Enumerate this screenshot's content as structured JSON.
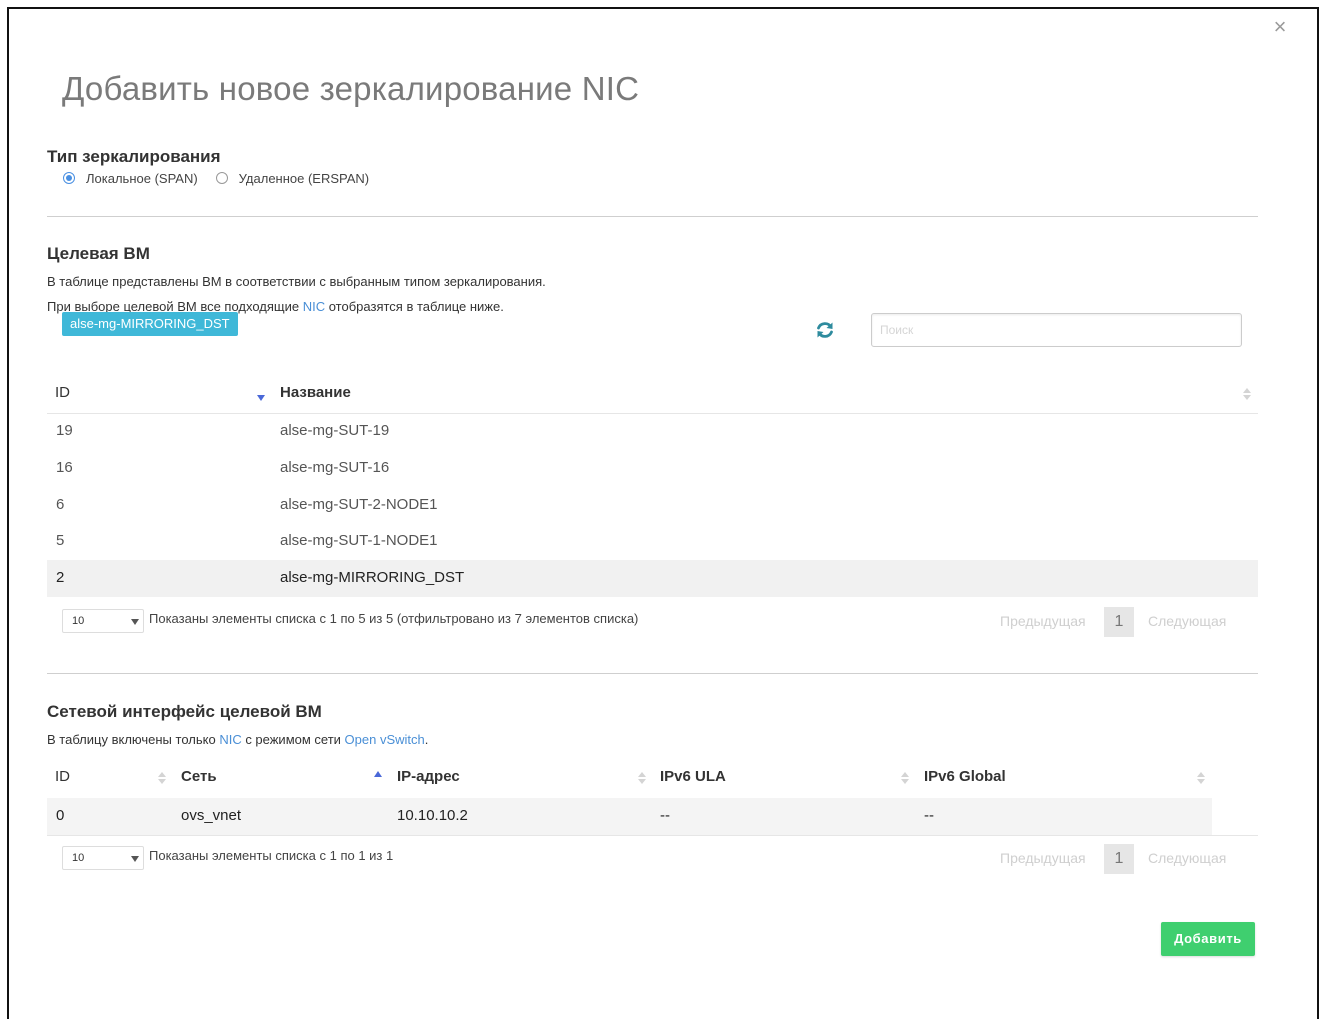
{
  "dialog": {
    "title": "Добавить новое зеркалирование NIC",
    "close_symbol": "×",
    "add_button": "Добавить"
  },
  "mirroring_type": {
    "heading": "Тип зеркалирования",
    "options": [
      {
        "label": "Локальное (SPAN)",
        "selected": true
      },
      {
        "label": "Удаленное (ERSPAN)",
        "selected": false
      }
    ]
  },
  "target_vm": {
    "heading": "Целевая ВМ",
    "desc1": "В таблице представлены ВМ в соответствии с выбранным типом зеркалирования.",
    "desc2_part1": "При выборе целевой ВМ все подходящие ",
    "desc2_link": "NIC",
    "desc2_part2": " отобразятся в таблице ниже.",
    "selected_tag": "alse-mg-MIRRORING_DST",
    "search_placeholder": "Поиск",
    "columns": [
      "ID",
      "Название"
    ],
    "rows": [
      {
        "id": "19",
        "name": "alse-mg-SUT-19",
        "selected": false
      },
      {
        "id": "16",
        "name": "alse-mg-SUT-16",
        "selected": false
      },
      {
        "id": "6",
        "name": "alse-mg-SUT-2-NODE1",
        "selected": false
      },
      {
        "id": "5",
        "name": "alse-mg-SUT-1-NODE1",
        "selected": false
      },
      {
        "id": "2",
        "name": "alse-mg-MIRRORING_DST",
        "selected": true
      }
    ],
    "page_size": "10",
    "info": "Показаны элементы списка с 1 по 5 из 5 (отфильтровано из 7 элементов списка)",
    "prev": "Предыдущая",
    "page": "1",
    "next": "Следующая"
  },
  "nic_table": {
    "heading": "Сетевой интерфейс целевой ВМ",
    "desc_part1": "В таблицу включены только ",
    "desc_link1": "NIC",
    "desc_part2": " с режимом сети ",
    "desc_link2": "Open vSwitch",
    "desc_part3": ".",
    "columns": [
      "ID",
      "Сеть",
      "IP-адрес",
      "IPv6 ULA",
      "IPv6 Global"
    ],
    "rows": [
      {
        "id": "0",
        "network": "ovs_vnet",
        "ip": "10.10.10.2",
        "ipv6_ula": "--",
        "ipv6_global": "--"
      }
    ],
    "page_size": "10",
    "info": "Показаны элементы списка с 1 по 1 из 1",
    "prev": "Предыдущая",
    "page": "1",
    "next": "Следующая"
  },
  "colors": {
    "accent_tag": "#3fb8d8",
    "add_button": "#3fcf6f",
    "sort_active": "#4a68d8",
    "link": "#4a8fd6"
  },
  "icons": [
    "close-icon",
    "refresh-icon",
    "sort-icon",
    "chevron-down-icon"
  ]
}
